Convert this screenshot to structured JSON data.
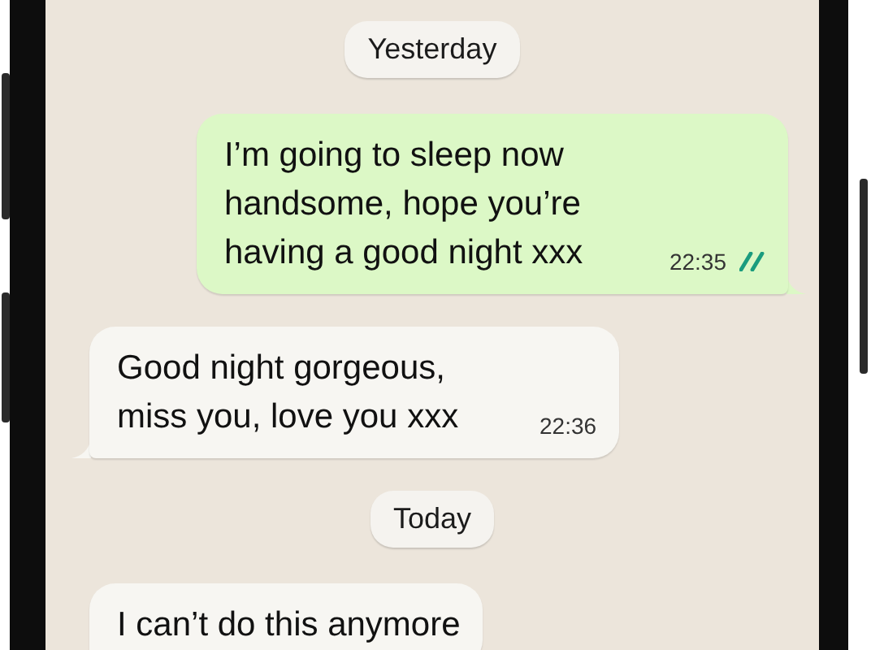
{
  "chat": [
    {
      "kind": "date",
      "label": "Yesterday"
    },
    {
      "kind": "message",
      "outgoing": true,
      "text": "I’m going to sleep now handsome, hope you’re having a good night xxx",
      "time": "22:35",
      "read": true
    },
    {
      "kind": "message",
      "outgoing": false,
      "text": "Good night gorgeous, miss you, love you xxx",
      "time": "22:36"
    },
    {
      "kind": "date",
      "label": "Today"
    },
    {
      "kind": "message",
      "outgoing": false,
      "text": "I can’t do this anymore"
    }
  ]
}
